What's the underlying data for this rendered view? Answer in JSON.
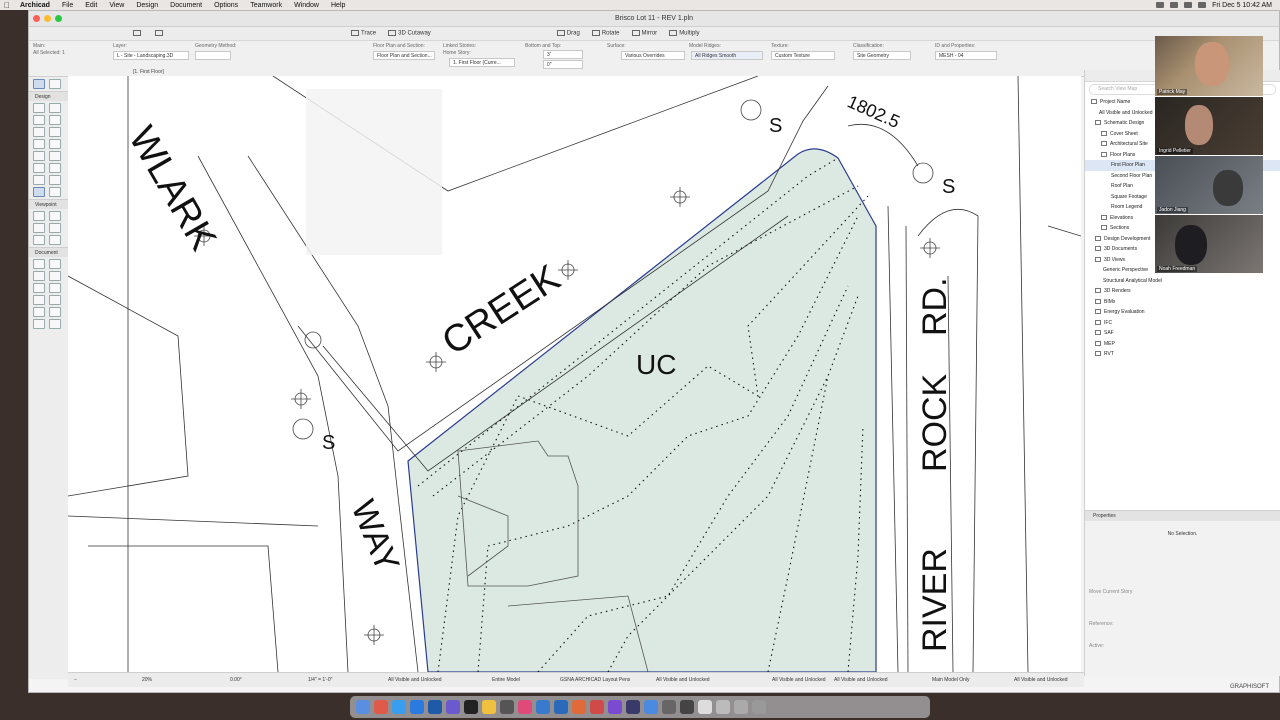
{
  "menubar": {
    "items": [
      "Archicad",
      "File",
      "Edit",
      "View",
      "Design",
      "Document",
      "Options",
      "Teamwork",
      "Window",
      "Help"
    ],
    "clock": "Fri Dec 5  10:42 AM"
  },
  "window": {
    "title": "Brisco Lot 11 - REV 1.pln"
  },
  "toolbar": {
    "items": [
      "Trace",
      "3D Cutaway",
      "Drag",
      "Rotate",
      "Mirror",
      "Multiply"
    ]
  },
  "infobox": {
    "main_label": "Main:",
    "all_selected": "All Selected: 1",
    "layer_label": "Layer:",
    "layer_value": "L - Site - Landscaping.3D",
    "geometry_label": "Geometry Method:",
    "section_label": "Floor Plan and Section:",
    "section_value": "Floor Plan and Section...",
    "linked_label": "Linked Stories:",
    "home_story_label": "Home Story:",
    "home_story_value": "1. First Floor (Curre...",
    "bottom_top_label": "Bottom and Top:",
    "bottom_value": "3'",
    "top_value": "0\"",
    "surface_label": "Surface:",
    "surface_value": "Various Overrides",
    "ridges_label": "Model Ridges:",
    "ridges_value": "All Ridges Smooth",
    "texture_label": "Texture:",
    "texture_value": "Custom Texture",
    "class_label": "Classification:",
    "class_value": "Site Geometry",
    "id_label": "ID and Properties:",
    "id_value": "MESH - 04"
  },
  "story_tab": "[1. First Floor]",
  "toolbox": {
    "sections": [
      "Design",
      "Viewpoint",
      "Document"
    ]
  },
  "canvas": {
    "labels": [
      "WLARK",
      "CREEK",
      "UC",
      "WAY",
      "RD.",
      "ROCK",
      "RIVER",
      "S",
      "S",
      "S",
      "1802.5"
    ]
  },
  "navigator": {
    "search_placeholder": "Search View Map",
    "items": [
      "Project Name",
      "All Visible and Unlocked",
      "Schematic Design",
      "Cover Sheet",
      "Architectural Site",
      "Floor Plans",
      "First Floor Plan",
      "Second Floor Plan",
      "Roof Plan",
      "Square Footage",
      "Room Legend",
      "Elevations",
      "Sections",
      "Design Development",
      "3D Documents",
      "3D Views",
      "Generic Perspective",
      "Structural Analytical Model",
      "3D Renders",
      "BIMx",
      "Energy Evaluation",
      "IFC",
      "SAF",
      "MEP",
      "RVT"
    ]
  },
  "properties": {
    "header": "Properties",
    "no_selection": "No Selection.",
    "move_story": "Move Current Story",
    "reference": "Reference:",
    "active": "Active:"
  },
  "statusbar": {
    "zoom": "20%",
    "angle": "0.00°",
    "scale": "1/4\" = 1'-0\"",
    "layers": "All Visible and Unlocked",
    "model": "Entire Model",
    "penset": "GSNA ARCHICAD Layout Pens",
    "layers2": "All Visible and Unlocked",
    "layers3": "All Visible and Unlocked",
    "layers4": "All Visible and Unlocked",
    "model_only": "Main Model Only",
    "layers5": "All Visible and Unlocked"
  },
  "brand": "GRAPHISOFT",
  "participants": [
    "Patrick May",
    "Ingrid Pelletier",
    "Jadon Jiang",
    "Noah Freedman"
  ]
}
